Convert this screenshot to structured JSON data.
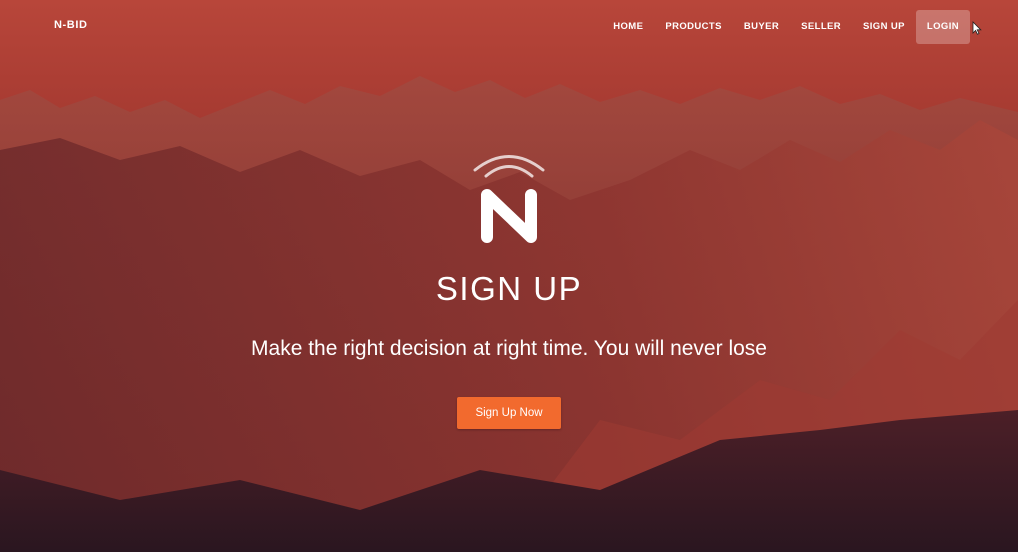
{
  "brand": "N-BID",
  "nav": {
    "home": "HOME",
    "products": "PRODUCTS",
    "buyer": "BUYER",
    "seller": "SELLER",
    "signup": "SIGN UP",
    "login": "LOGIN"
  },
  "hero": {
    "logo_icon": "n-wifi-logo-icon",
    "title": "SIGN UP",
    "subtitle": "Make the right decision at right time. You will never lose",
    "cta_label": "Sign Up Now"
  },
  "colors": {
    "overlay": "#b8392f",
    "cta": "#f26a2e",
    "text": "#ffffff"
  }
}
